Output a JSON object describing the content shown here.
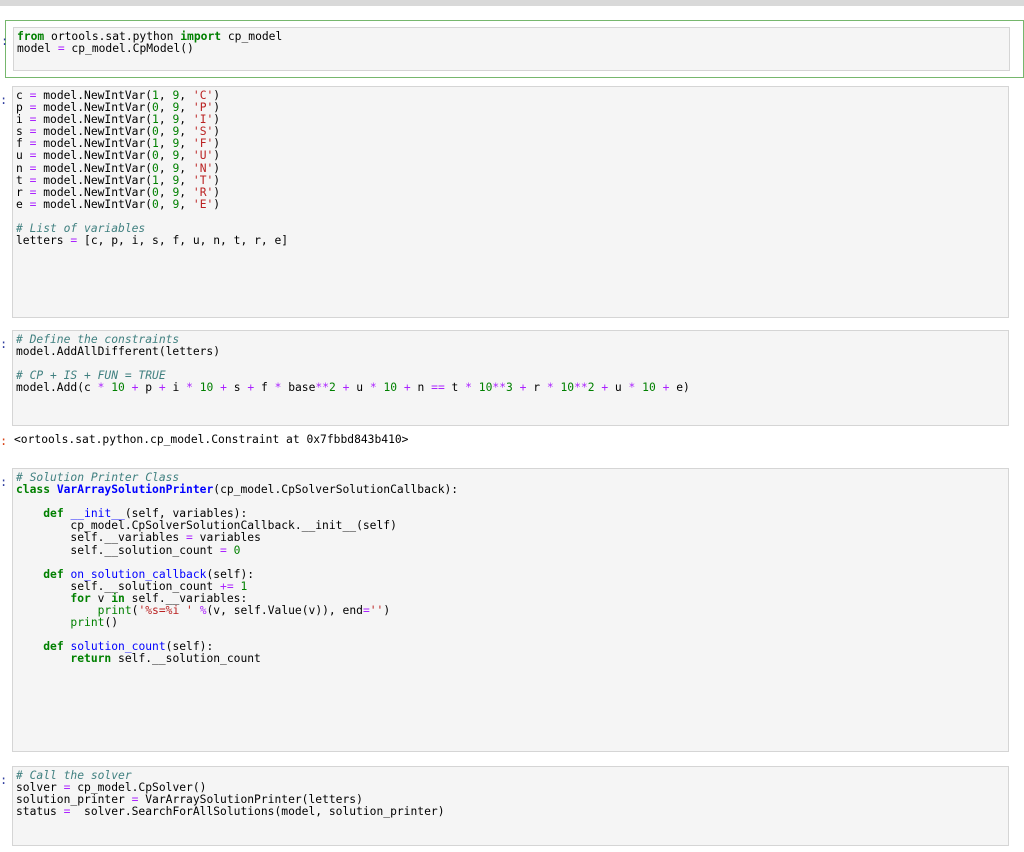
{
  "notebook": {
    "prompt_marker": ":",
    "cells": [
      {
        "id": "cell-1",
        "lines": [
          "from ortools.sat.python import cp_model",
          "model = cp_model.CpModel()"
        ]
      },
      {
        "id": "cell-2",
        "lines": [
          "c = model.NewIntVar(1, 9, 'C')",
          "p = model.NewIntVar(0, 9, 'P')",
          "i = model.NewIntVar(1, 9, 'I')",
          "s = model.NewIntVar(0, 9, 'S')",
          "f = model.NewIntVar(1, 9, 'F')",
          "u = model.NewIntVar(0, 9, 'U')",
          "n = model.NewIntVar(0, 9, 'N')",
          "t = model.NewIntVar(1, 9, 'T')",
          "r = model.NewIntVar(0, 9, 'R')",
          "e = model.NewIntVar(0, 9, 'E')",
          "",
          "# List of variables",
          "letters = [c, p, i, s, f, u, n, t, r, e]"
        ]
      },
      {
        "id": "cell-3",
        "lines": [
          "# Define the constraints",
          "model.AddAllDifferent(letters)",
          "",
          "# CP + IS + FUN = TRUE",
          "model.Add(c * 10 + p + i * 10 + s + f * base**2 + u * 10 + n == t * 10**3 + r * 10**2 + u * 10 + e)"
        ],
        "output": "<ortools.sat.python.cp_model.Constraint at 0x7fbbd843b410>"
      },
      {
        "id": "cell-4",
        "lines": [
          "# Solution Printer Class",
          "class VarArraySolutionPrinter(cp_model.CpSolverSolutionCallback):",
          "",
          "    def __init__(self, variables):",
          "        cp_model.CpSolverSolutionCallback.__init__(self)",
          "        self.__variables = variables",
          "        self.__solution_count = 0",
          "",
          "    def on_solution_callback(self):",
          "        self.__solution_count += 1",
          "        for v in self.__variables:",
          "            print('%s=%i ' %(v, self.Value(v)), end='')",
          "        print()",
          "",
          "    def solution_count(self):",
          "        return self.__solution_count"
        ]
      },
      {
        "id": "cell-5",
        "lines": [
          "# Call the solver",
          "solver = cp_model.CpSolver()",
          "solution_printer = VarArraySolutionPrinter(letters)",
          "status =  solver.SearchForAllSolutions(model, solution_printer)"
        ]
      }
    ]
  },
  "colors": {
    "keyword": "#008000",
    "string": "#ba2121",
    "operator": "#aa22ff",
    "comment": "#408080",
    "function_name": "#0000ff",
    "selected_cell_border": "#76b76d",
    "input_background": "#f5f5f5"
  }
}
